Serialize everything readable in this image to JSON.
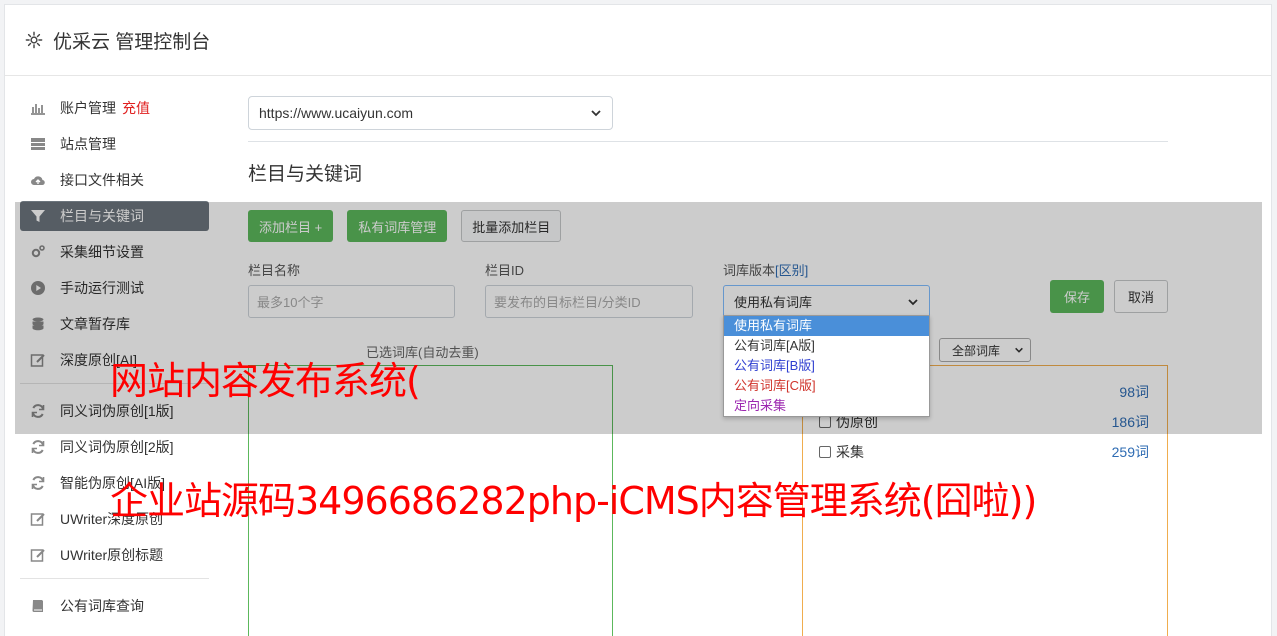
{
  "header": {
    "title": "优采云 管理控制台",
    "icon": "gear-icon"
  },
  "sidebar": {
    "items": [
      {
        "label": "账户管理",
        "badge": "充值",
        "icon": "bar-chart-icon"
      },
      {
        "label": "站点管理",
        "icon": "server-icon"
      },
      {
        "label": "接口文件相关",
        "icon": "cloud-upload-icon"
      },
      {
        "label": "栏目与关键词",
        "icon": "filter-icon",
        "active": true
      },
      {
        "label": "采集细节设置",
        "icon": "cogs-icon"
      },
      {
        "label": "手动运行测试",
        "icon": "play-circle-icon"
      },
      {
        "label": "文章暂存库",
        "icon": "database-icon"
      },
      {
        "label": "深度原创[AI]",
        "icon": "edit-icon"
      },
      {
        "label": "同义词伪原创[1版]",
        "icon": "refresh-icon"
      },
      {
        "label": "同义词伪原创[2版]",
        "icon": "refresh-icon"
      },
      {
        "label": "智能伪原创[AI版]",
        "icon": "refresh-icon"
      },
      {
        "label": "UWriter深度原创",
        "icon": "edit-icon"
      },
      {
        "label": "UWriter原创标题",
        "icon": "edit-icon"
      },
      {
        "label": "公有词库查询",
        "icon": "book-icon"
      }
    ]
  },
  "main": {
    "site_select": "https://www.ucaiyun.com",
    "section_title": "栏目与关键词",
    "toolbar": {
      "add_column": "添加栏目 +",
      "private_lib": "私有词库管理",
      "batch_add": "批量添加栏目"
    },
    "form": {
      "column_name_label": "栏目名称",
      "column_name_placeholder": "最多10个字",
      "column_id_label": "栏目ID",
      "column_id_placeholder": "要发布的目标栏目/分类ID",
      "lib_version_label": "词库版本",
      "lib_version_link": "[区别]",
      "lib_version_value": "使用私有词库",
      "save": "保存",
      "cancel": "取消"
    },
    "selected_label": "已选词库(自动去重)",
    "all_libs_select": "全部词库",
    "lib_list": [
      {
        "name": "",
        "count": "98词"
      },
      {
        "name": "伪原创",
        "count": "186词"
      },
      {
        "name": "采集",
        "count": "259词"
      }
    ],
    "dropdown_options": [
      {
        "label": "使用私有词库",
        "color": "#ffffff",
        "selected": true
      },
      {
        "label": "公有词库[A版]",
        "color": "#333333"
      },
      {
        "label": "公有词库[B版]",
        "color": "#2f3fd0"
      },
      {
        "label": "公有词库[C版]",
        "color": "#d0342c"
      },
      {
        "label": "定向采集",
        "color": "#9c27b0"
      }
    ]
  },
  "watermark": {
    "line1": "网站内容发布系统(",
    "line2": "企业站源码3496686282php-iCMS内容管理系统(囧啦))"
  }
}
